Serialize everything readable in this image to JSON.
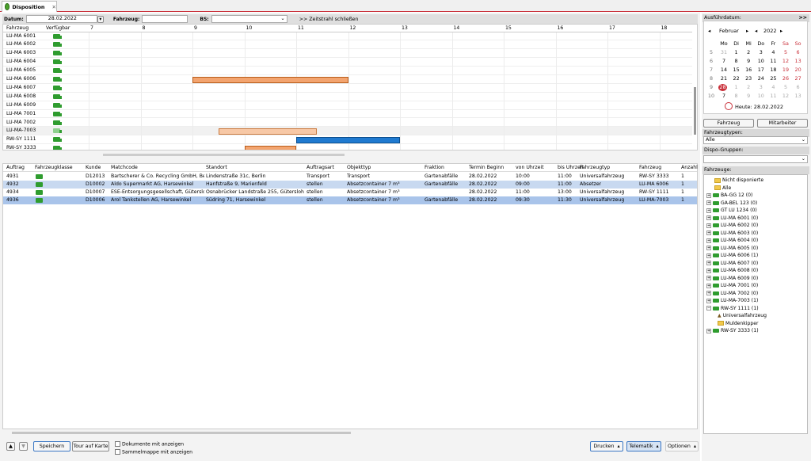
{
  "tab": {
    "title": "Disposition"
  },
  "filter": {
    "datum_label": "Datum:",
    "datum_value": "28.02.2022",
    "fahrzeug_label": "Fahrzeug:",
    "fahrzeug_value": "",
    "bs_label": "BS:",
    "bs_value": "",
    "zeitstrahl_button": ">> Zeitstrahl schließen"
  },
  "gantt": {
    "col_fahrzeug": "Fahrzeug",
    "col_verfuegbar": "Verfügbar",
    "hours": [
      "7",
      "8",
      "9",
      "10",
      "11",
      "12",
      "13",
      "14",
      "15",
      "16",
      "17",
      "18"
    ],
    "rows": [
      "LU-MA 6001",
      "LU-MA 6002",
      "LU-MA 6003",
      "LU-MA 6004",
      "LU-MA 6005",
      "LU-MA 6006",
      "LU-MA 6007",
      "LU-MA 6008",
      "LU-MA 6009",
      "LU-MA 7001",
      "LU-MA 7002",
      "LU-MA-7003",
      "RW-SY 1111",
      "RW-SY 3333"
    ],
    "bars": [
      {
        "row": 5,
        "start": 9.0,
        "end": 12.0,
        "style": "o"
      },
      {
        "row": 11,
        "start": 9.5,
        "end": 11.4,
        "style": "ol"
      },
      {
        "row": 12,
        "start": 11.0,
        "end": 13.0,
        "style": "b"
      },
      {
        "row": 13,
        "start": 10.0,
        "end": 11.0,
        "style": "o"
      }
    ]
  },
  "table": {
    "headers": [
      "Auftrag",
      "Fahrzeugklasse",
      "Kunde",
      "Matchcode",
      "Standort",
      "Auftragsart",
      "Objekttyp",
      "Fraktion",
      "Termin Beginn",
      "von Uhrzeit",
      "bis Uhrzeit",
      "Fahrzeugtyp",
      "Fahrzeug",
      "Anzahl"
    ],
    "rows": [
      [
        "4931",
        "",
        "D12013",
        "Bartscherer & Co. Recycling GmbH, Ber...",
        "Lindenstraße 31c, Berlin",
        "Transport",
        "Transport",
        "Gartenabfälle",
        "28.02.2022",
        "10:00",
        "11:00",
        "Universalfahrzeug",
        "RW-SY 3333",
        "1"
      ],
      [
        "4932",
        "",
        "D10002",
        "Aldo Supermarkt AG, Harsewinkel",
        "Hanfstraße 9, Marienfeld",
        "stellen",
        "Absetzcontainer 7 m³",
        "Gartenabfälle",
        "28.02.2022",
        "09:00",
        "11:00",
        "Absetzer",
        "LU-MA 6006",
        "1"
      ],
      [
        "4934",
        "",
        "D10007",
        "ESE-Entsorgungsgesellschaft, Gütersloh",
        "Osnabrücker Landstraße 255, Gütersloh",
        "stellen",
        "Absetzcontainer 7 m³",
        "",
        "28.02.2022",
        "11:00",
        "13:00",
        "Universalfahrzeug",
        "RW-SY 1111",
        "1"
      ],
      [
        "4936",
        "",
        "D10006",
        "Arol Tankstellen AG, Harsewinkel",
        "Südring 71, Harsewinkel",
        "stellen",
        "Absetzcontainer 7 m³",
        "Gartenabfälle",
        "28.02.2022",
        "09:30",
        "11:30",
        "Universalfahrzeug",
        "LU-MA-7003",
        "1"
      ]
    ]
  },
  "bottom": {
    "save": "Speichern",
    "tour": "Tour auf Karte",
    "cb1": "Dokumente mit anzeigen",
    "cb2": "Sammelmappe mit anzeigen",
    "print": "Drucken",
    "telematik": "Telematik",
    "options": "Optionen"
  },
  "right": {
    "ausfuehr_label": "Ausführdatum:",
    "collapse": ">>",
    "month": "Februar",
    "year": "2022",
    "weekdays": [
      "Mo",
      "Di",
      "Mi",
      "Do",
      "Fr",
      "Sa",
      "So"
    ],
    "weeks": [
      {
        "kw": "5",
        "days": [
          "31",
          "1",
          "2",
          "3",
          "4",
          "5",
          "6"
        ]
      },
      {
        "kw": "6",
        "days": [
          "7",
          "8",
          "9",
          "10",
          "11",
          "12",
          "13"
        ]
      },
      {
        "kw": "7",
        "days": [
          "14",
          "15",
          "16",
          "17",
          "18",
          "19",
          "20"
        ]
      },
      {
        "kw": "8",
        "days": [
          "21",
          "22",
          "23",
          "24",
          "25",
          "26",
          "27"
        ]
      },
      {
        "kw": "9",
        "days": [
          "28",
          "1",
          "2",
          "3",
          "4",
          "5",
          "6"
        ]
      },
      {
        "kw": "10",
        "days": [
          "7",
          "8",
          "9",
          "10",
          "11",
          "12",
          "13"
        ]
      }
    ],
    "today": "Heute: 28.02.2022",
    "tab_fahrzeug": "Fahrzeug",
    "tab_mitarbeiter": "Mitarbeiter",
    "typen_label": "Fahrzeugtypen:",
    "typen_value": "Alle",
    "dispo_label": "Dispo-Gruppen:",
    "dispo_value": "",
    "fahrzeuge_label": "Fahrzeuge:",
    "tree": [
      {
        "label": "Nicht disponierte",
        "kind": "folder",
        "indent": 0
      },
      {
        "label": "Alle",
        "kind": "folder",
        "indent": 0
      },
      {
        "label": "BA-GG 12 (0)",
        "kind": "truck",
        "indent": 0
      },
      {
        "label": "GA-BEL 123 (0)",
        "kind": "truck",
        "indent": 0
      },
      {
        "label": "GT LU 1234 (0)",
        "kind": "truck",
        "indent": 0
      },
      {
        "label": "LU-MA 6001 (0)",
        "kind": "truck",
        "indent": 0
      },
      {
        "label": "LU-MA 6002 (0)",
        "kind": "truck",
        "indent": 0
      },
      {
        "label": "LU-MA 6003 (0)",
        "kind": "truck",
        "indent": 0
      },
      {
        "label": "LU-MA 6004 (0)",
        "kind": "truck",
        "indent": 0
      },
      {
        "label": "LU-MA 6005 (0)",
        "kind": "truck",
        "indent": 0
      },
      {
        "label": "LU-MA 6006 (1)",
        "kind": "truck",
        "indent": 0
      },
      {
        "label": "LU-MA 6007 (0)",
        "kind": "truck",
        "indent": 0
      },
      {
        "label": "LU-MA 6008 (0)",
        "kind": "truck",
        "indent": 0
      },
      {
        "label": "LU-MA 6009 (0)",
        "kind": "truck",
        "indent": 0
      },
      {
        "label": "LU-MA 7001 (0)",
        "kind": "truck",
        "indent": 0
      },
      {
        "label": "LU-MA 7002 (0)",
        "kind": "truck",
        "indent": 0
      },
      {
        "label": "LU-MA-7003 (1)",
        "kind": "truck",
        "indent": 0
      },
      {
        "label": "RW-SY 1111 (1)",
        "kind": "truck",
        "indent": 0
      },
      {
        "label": "Universalfahrzeug",
        "kind": "sub",
        "indent": 1
      },
      {
        "label": "Muldenkipper",
        "kind": "folder",
        "indent": 1
      },
      {
        "label": "RW-SY 3333 (1)",
        "kind": "truck",
        "indent": 0
      }
    ]
  }
}
